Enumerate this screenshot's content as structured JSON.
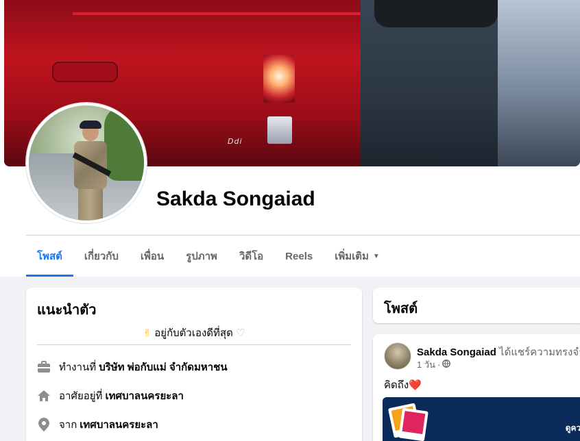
{
  "profile": {
    "name": "Sakda Songaiad",
    "cover_badge": "Ddi"
  },
  "tabs": [
    {
      "label": "โพสต์",
      "active": true
    },
    {
      "label": "เกี่ยวกับ"
    },
    {
      "label": "เพื่อน"
    },
    {
      "label": "รูปภาพ"
    },
    {
      "label": "วิดีโอ"
    },
    {
      "label": "Reels"
    },
    {
      "label": "เพิ่มเติม"
    }
  ],
  "intro": {
    "title": "แนะนำตัว",
    "bio_emoji": "✌",
    "bio_text": "อยู่กับตัวเองดีที่สุด",
    "bio_heart": "♡",
    "work_prefix": "ทำงานที่",
    "work_value": "บริษัท พ่อกับแม่ จำกัดมหาชน",
    "lives_prefix": "อาศัยอยู่ที่",
    "lives_value": "เทศบาลนครยะลา",
    "from_prefix": "จาก",
    "from_value": "เทศบาลนครยะลา"
  },
  "posts_section": {
    "title": "โพสต์"
  },
  "post": {
    "author": "Sakda Songaiad",
    "action": "ได้แชร์ความทรงจำ",
    "time": "1 วัน",
    "time_sep": "·",
    "text": "คิดถึง",
    "text_emoji": "❤️",
    "memory_text": "ดูควา"
  },
  "colors": {
    "accent": "#1877f2",
    "text_primary": "#050505",
    "text_secondary": "#65676b",
    "background": "#f0f2f5"
  },
  "icons": {
    "work": "briefcase-icon",
    "lives": "home-icon",
    "from": "location-pin-icon",
    "privacy": "globe-icon",
    "more": "caret-down-icon"
  }
}
